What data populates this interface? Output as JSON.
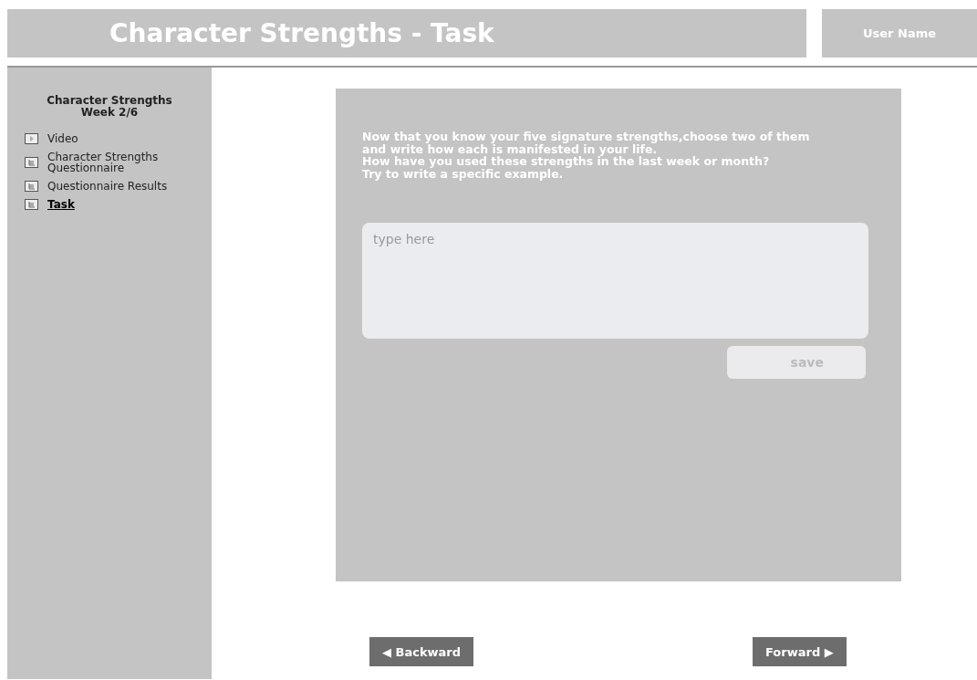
{
  "header": {
    "title": "Character Strengths - Task",
    "user": "User Name"
  },
  "sidebar": {
    "title": "Character Strengths",
    "subtitle": "Week 2/6",
    "items": [
      {
        "label": "Video",
        "kind": "video",
        "selected": false
      },
      {
        "label": "Character Strengths Questionnaire",
        "kind": "document",
        "selected": false
      },
      {
        "label": "Questionnaire Results",
        "kind": "document",
        "selected": false
      },
      {
        "label": "Task",
        "kind": "document",
        "selected": true
      }
    ]
  },
  "task": {
    "instructions": [
      "Now that you know your five signature strengths,choose two of them",
      "and write how each is manifested in your life.",
      "How have you used these strengths in the last week or month?",
      "Try to write a specific example."
    ],
    "answer": {
      "placeholder": "type here"
    },
    "save": "save"
  },
  "nav": {
    "backward": {
      "label": "Backward",
      "icon": "◀"
    },
    "forward": {
      "label": "Forward",
      "icon": "▶"
    }
  }
}
